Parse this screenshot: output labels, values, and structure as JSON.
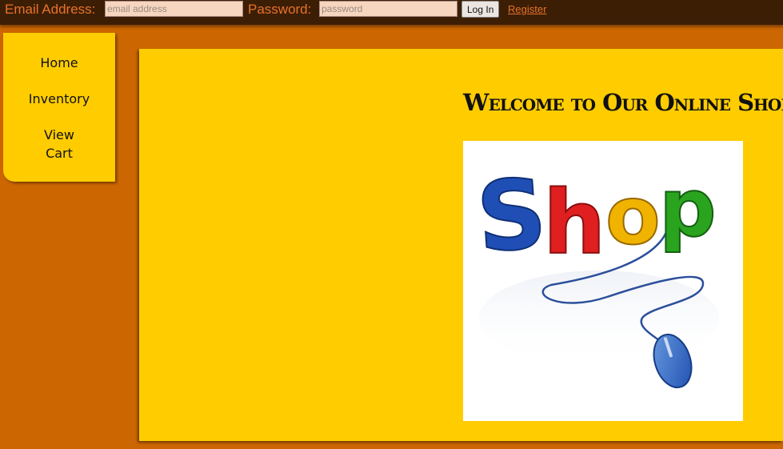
{
  "login": {
    "email_label": "Email Address:",
    "email_placeholder": "email address",
    "password_label": "Password:",
    "password_placeholder": "password",
    "login_button": "Log In",
    "register_link": "Register"
  },
  "nav": {
    "items": [
      {
        "label": "Home"
      },
      {
        "label": "Inventory"
      },
      {
        "label": "View"
      },
      {
        "label": "Cart"
      }
    ]
  },
  "main": {
    "heading": "Welcome to Our Online Shop!",
    "image_text": "Shop"
  },
  "colors": {
    "page_bg": "#cc6600",
    "topbar_bg": "#3c1e05",
    "panel_bg": "#ffcc00",
    "label_orange": "#e8722a"
  }
}
